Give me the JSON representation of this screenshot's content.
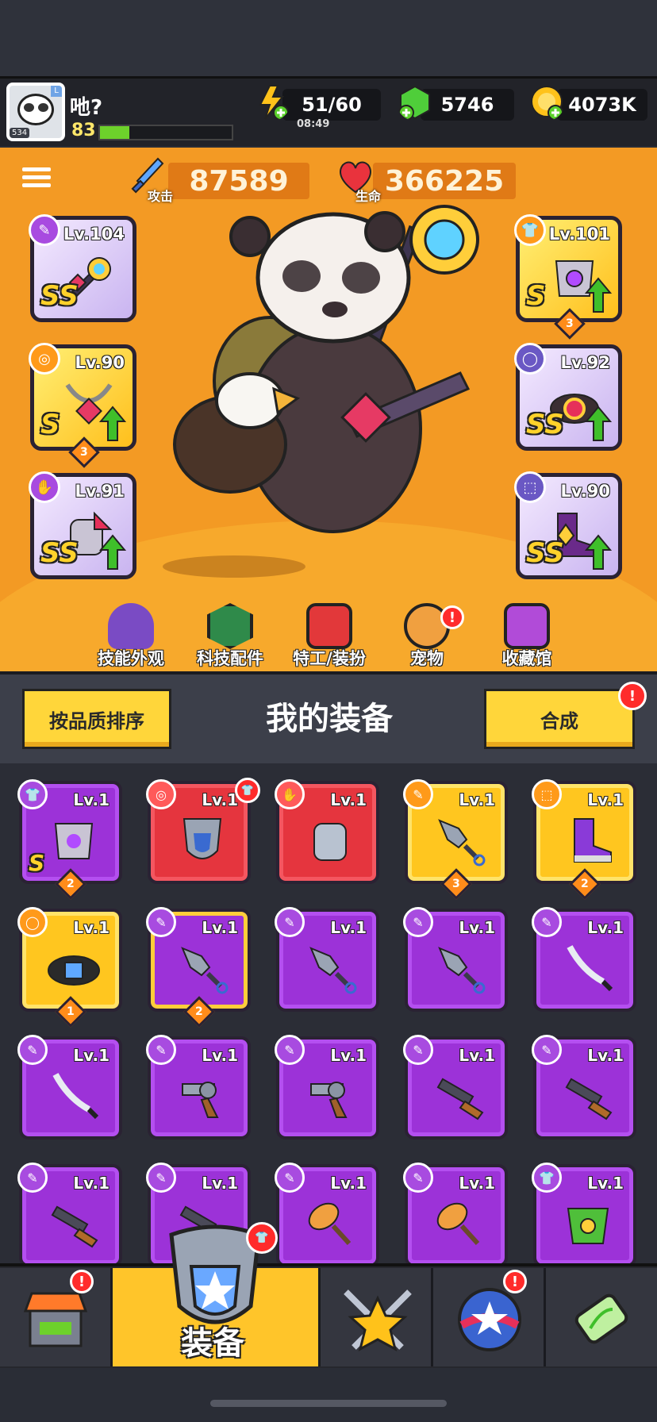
{
  "player": {
    "name": "吔?",
    "level": "83",
    "rank": "534",
    "xp_fraction": 0.22
  },
  "resources": {
    "energy": "51/60",
    "energy_timer": "08:49",
    "gems": "5746",
    "gold": "4073K"
  },
  "stats": {
    "attack_label": "攻击",
    "attack_value": "87589",
    "hp_label": "生命",
    "hp_value": "366225"
  },
  "equipped": {
    "weapon": {
      "level": "Lv.104",
      "grade": "SS"
    },
    "necklace": {
      "level": "Lv.90",
      "grade": "S",
      "stars": "3"
    },
    "gloves": {
      "level": "Lv.91",
      "grade": "SS"
    },
    "armor": {
      "level": "Lv.101",
      "grade": "S",
      "stars": "3"
    },
    "belt": {
      "level": "Lv.92",
      "grade": "SS"
    },
    "boots": {
      "level": "Lv.90",
      "grade": "SS"
    }
  },
  "features": [
    {
      "label": "技能外观"
    },
    {
      "label": "科技配件"
    },
    {
      "label": "特工/装扮"
    },
    {
      "label": "宠物"
    },
    {
      "label": "收藏馆"
    }
  ],
  "inventory_header": {
    "sort_button": "按品质排序",
    "title": "我的装备",
    "merge_button": "合成"
  },
  "inventory": [
    {
      "level": "Lv.1",
      "grade": "S",
      "stars": "2"
    },
    {
      "level": "Lv.1"
    },
    {
      "level": "Lv.1"
    },
    {
      "level": "Lv.1",
      "stars": "3"
    },
    {
      "level": "Lv.1",
      "stars": "2"
    },
    {
      "level": "Lv.1",
      "stars": "1"
    },
    {
      "level": "Lv.1",
      "stars": "2"
    },
    {
      "level": "Lv.1"
    },
    {
      "level": "Lv.1"
    },
    {
      "level": "Lv.1"
    },
    {
      "level": "Lv.1"
    },
    {
      "level": "Lv.1"
    },
    {
      "level": "Lv.1"
    },
    {
      "level": "Lv.1"
    },
    {
      "level": "Lv.1"
    },
    {
      "level": "Lv.1"
    },
    {
      "level": "Lv.1"
    },
    {
      "level": "Lv.1"
    },
    {
      "level": "Lv.1"
    },
    {
      "level": "Lv.1"
    }
  ],
  "nav": {
    "active_label": "装备"
  },
  "colors": {
    "orange": "#f39a24",
    "purple": "#9c32d8",
    "red": "#e5353e",
    "gold": "#ffc61f",
    "alert": "#ff2b2b"
  }
}
